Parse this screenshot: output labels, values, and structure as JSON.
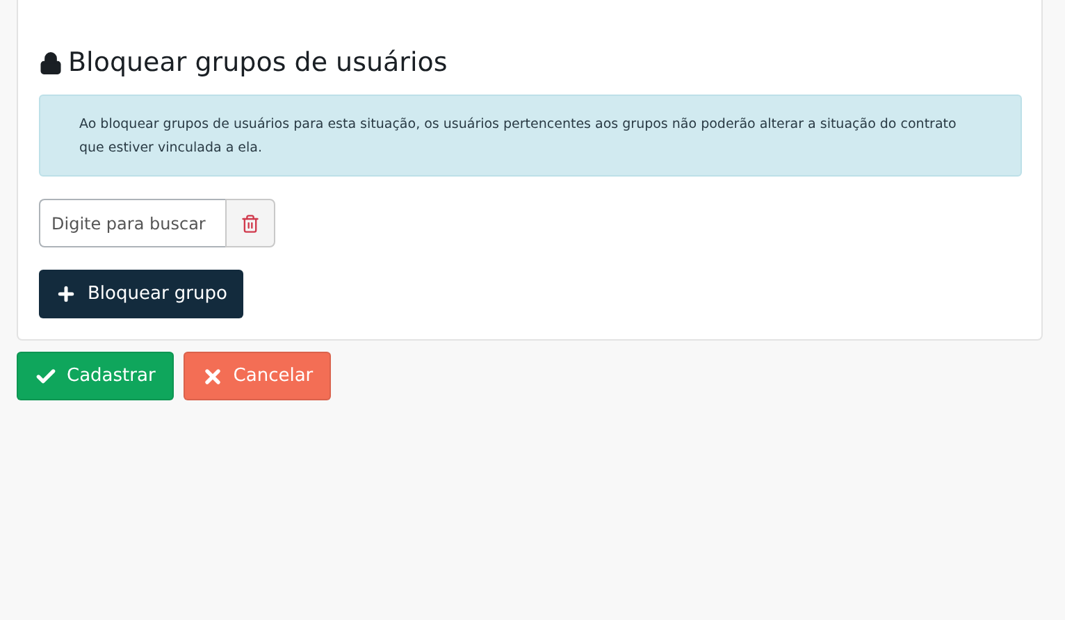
{
  "section": {
    "title": "Bloquear grupos de usuários",
    "message": "Ao bloquear grupos de usuários para esta situação, os usuários pertencentes aos grupos não poderão alterar a situação do contrato que estiver vinculada a ela.",
    "search": {
      "placeholder": "Digite para buscar"
    },
    "add_button": "Bloquear grupo"
  },
  "actions": [
    {
      "label": "Cadastrar",
      "kind": "submit"
    },
    {
      "label": "Cancelar",
      "kind": "cancel"
    }
  ]
}
